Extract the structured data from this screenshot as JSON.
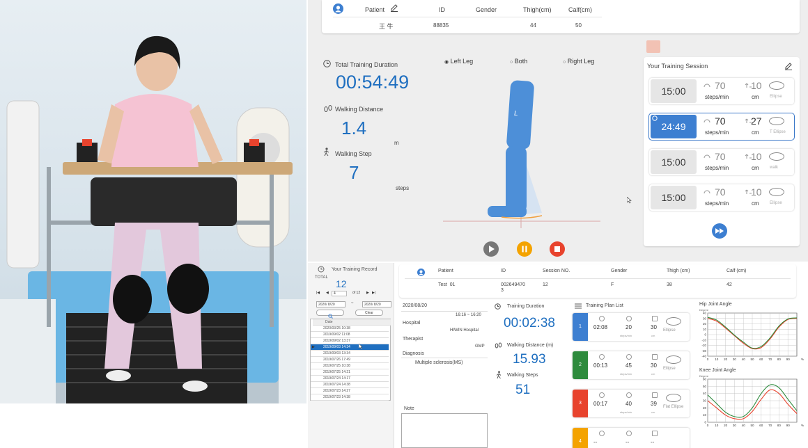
{
  "top_patient": {
    "headers": [
      "Patient",
      "ID",
      "Gender",
      "Thigh(cm)",
      "Calf(cm)"
    ],
    "values": [
      "王 牛",
      "88835",
      "",
      "44",
      "50"
    ]
  },
  "training": {
    "duration_label": "Total Training Duration",
    "duration": "00:54:49",
    "distance_label": "Walking Distance",
    "distance": "1.4",
    "distance_unit": "m",
    "steps_label": "Walking Step",
    "steps": "7",
    "steps_unit": "steps"
  },
  "leg_select": {
    "options": [
      "Left Leg",
      "Both",
      "Right Leg"
    ],
    "selected": "Left Leg"
  },
  "leg_figure_label": "L",
  "session": {
    "title": "Your Training Session",
    "rows": [
      {
        "time": "15:00",
        "cadence": "70",
        "cadence_unit": "steps/min",
        "length": "10",
        "length_unit": "cm",
        "mode": "Ellipse",
        "active": false
      },
      {
        "time": "24:49",
        "cadence": "70",
        "cadence_unit": "steps/min",
        "length": "27",
        "length_unit": "cm",
        "mode": "T Ellipse",
        "active": true
      },
      {
        "time": "15:00",
        "cadence": "70",
        "cadence_unit": "steps/min",
        "length": "10",
        "length_unit": "cm",
        "mode": "walk",
        "active": false
      },
      {
        "time": "15:00",
        "cadence": "70",
        "cadence_unit": "steps/min",
        "length": "10",
        "length_unit": "cm",
        "mode": "Ellipse",
        "active": false
      }
    ]
  },
  "colors": {
    "accent_blue": "#1f6fc0",
    "play": "#777777",
    "pause": "#f4a300",
    "stop": "#e8432d"
  },
  "record": {
    "title": "Your Training Record",
    "total_label": "TOTAL",
    "total": "12",
    "pager_page": "4",
    "pager_total": "of 12",
    "date_from": "2020/ 8/20",
    "date_sep": "~",
    "date_to": "2020/ 8/20",
    "clear_label": "Clear",
    "column_header": "Date",
    "rows": [
      "2020/03/25 10:38",
      "2019/09/02 11:08",
      "2019/09/02 13:37",
      "2019/09/03 14:34",
      "2019/09/03 13:34",
      "2019/07/26 17:49",
      "2019/07/25 10:38",
      "2019/07/25 14:21",
      "2019/07/24 14:17",
      "2019/07/24 14:38",
      "2019/07/23 14:27",
      "2019/07/23 14:38"
    ],
    "selected_index": 3
  },
  "bottom_patient": {
    "headers": [
      "Patient",
      "ID",
      "Session NO.",
      "Gender",
      "Thigh (cm)",
      "Calf (cm)"
    ],
    "values": [
      "Test  01",
      "002649470\n3",
      "12",
      "F",
      "38",
      "42"
    ]
  },
  "details": {
    "date": "2020/08/20",
    "time_range": "16:16 ~ 16:20",
    "hospital_label": "Hospital",
    "hospital": "HIWIN Hospital",
    "therapist_label": "Therapist",
    "therapist": "GMP",
    "diagnosis_label": "Diagnosis",
    "diagnosis": "Multiple sclerosis(MS)",
    "note_label": "Note"
  },
  "summary": {
    "duration_label": "Training Duration",
    "duration": "00:02:38",
    "distance_label": "Walking Distance (m)",
    "distance": "15.93",
    "steps_label": "Walking Steps",
    "steps": "51"
  },
  "plan": {
    "title": "Training Plan List",
    "items": [
      {
        "no": "1",
        "color": "#3d7fd1",
        "time": "02:08",
        "cadence": "20",
        "cadence_unit": "steps/min",
        "length": "30",
        "length_unit": "cm",
        "mode": "Ellipse"
      },
      {
        "no": "2",
        "color": "#2e8b3d",
        "time": "00:13",
        "cadence": "45",
        "cadence_unit": "steps/min",
        "length": "30",
        "length_unit": "cm",
        "mode": "Ellipse"
      },
      {
        "no": "3",
        "color": "#e8432d",
        "time": "00:17",
        "cadence": "40",
        "cadence_unit": "steps/min",
        "length": "39",
        "length_unit": "cm",
        "mode": "Flat Ellipse"
      },
      {
        "no": "4",
        "color": "#f4a300",
        "time": "--",
        "cadence": "--",
        "cadence_unit": "",
        "length": "--",
        "length_unit": "",
        "mode": ""
      }
    ]
  },
  "chart_data": [
    {
      "type": "line",
      "title": "Hip Joint Angle",
      "ylabel": "Degree",
      "xlabel": "%",
      "x": [
        0,
        10,
        20,
        30,
        40,
        50,
        60,
        70,
        80,
        90,
        100
      ],
      "ylim": [
        -40,
        40
      ],
      "xlim": [
        0,
        100
      ],
      "yticks": [
        40,
        30,
        20,
        10,
        0,
        -10,
        -20,
        -30,
        -40
      ],
      "xticks": [
        0,
        10,
        20,
        30,
        40,
        50,
        60,
        70,
        80,
        90
      ],
      "series": [
        {
          "color": "#e8432d",
          "values": [
            30,
            25,
            12,
            -2,
            -16,
            -26,
            -24,
            -8,
            14,
            28,
            30
          ]
        },
        {
          "color": "#2e8b3d",
          "values": [
            32,
            27,
            14,
            -1,
            -14,
            -25,
            -22,
            -6,
            16,
            29,
            31
          ]
        }
      ]
    },
    {
      "type": "line",
      "title": "Knee Joint Angle",
      "ylabel": "Degree",
      "xlabel": "%",
      "x": [
        0,
        10,
        20,
        30,
        40,
        50,
        60,
        70,
        80,
        90,
        100
      ],
      "ylim": [
        0,
        60
      ],
      "xlim": [
        0,
        100
      ],
      "yticks": [
        60,
        50,
        40,
        30,
        20,
        10,
        0
      ],
      "xticks": [
        0,
        10,
        20,
        30,
        40,
        50,
        60,
        70,
        80,
        90
      ],
      "series": [
        {
          "color": "#e8432d",
          "values": [
            30,
            20,
            10,
            5,
            5,
            15,
            32,
            45,
            40,
            25,
            12
          ]
        },
        {
          "color": "#2e8b3d",
          "values": [
            38,
            26,
            14,
            8,
            8,
            20,
            40,
            52,
            48,
            32,
            16
          ]
        }
      ]
    }
  ]
}
